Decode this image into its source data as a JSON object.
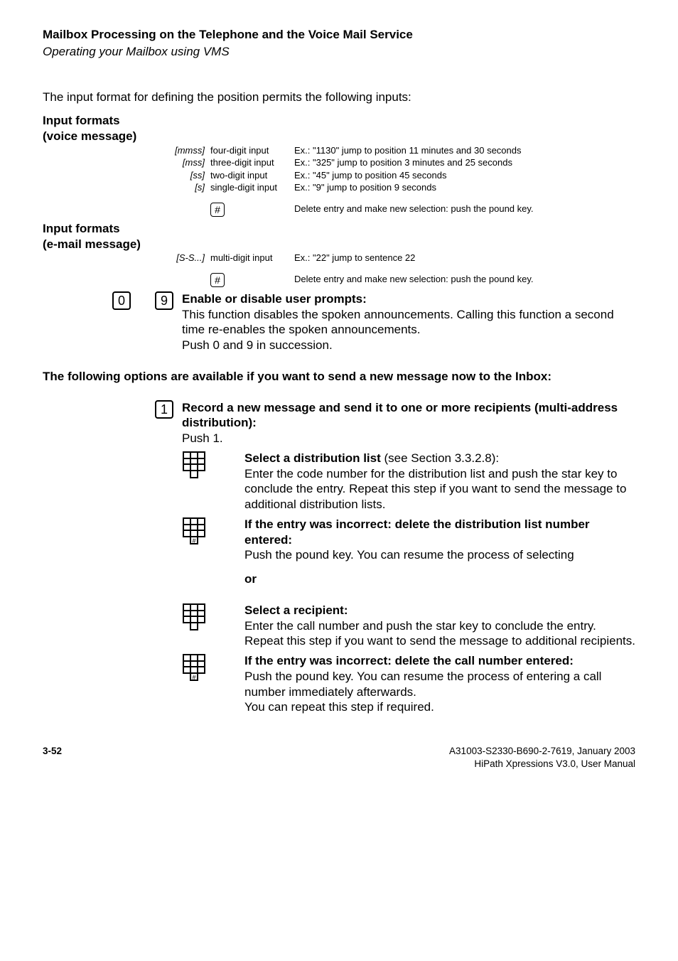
{
  "header": {
    "title": "Mailbox Processing on the Telephone and the Voice Mail Service",
    "subtitle": "Operating your Mailbox using VMS"
  },
  "intro": "The input format for defining the position permits the following inputs:",
  "input_formats_voice": {
    "heading_l1": "Input formats",
    "heading_l2": "(voice message)",
    "rows": [
      {
        "tag": "[mmss]",
        "label": "four-digit input",
        "ex": "Ex.: \"1130\" jump to position 11 minutes and 30 seconds"
      },
      {
        "tag": "[mss]",
        "label": "three-digit input",
        "ex": "Ex.: \"325\" jump to position 3 minutes and 25 seconds"
      },
      {
        "tag": "[ss]",
        "label": "two-digit input",
        "ex": "Ex.: \"45\" jump to position 45 seconds"
      },
      {
        "tag": "[s]",
        "label": "single-digit input",
        "ex": "Ex.: \"9\" jump to position 9 seconds"
      }
    ],
    "delete_key": "#",
    "delete_text": "Delete entry and make new selection: push the pound key."
  },
  "input_formats_email": {
    "heading_l1": "Input formats",
    "heading_l2": "(e-mail message)",
    "row": {
      "tag": "[S-S...]",
      "label": "multi-digit input",
      "ex": "Ex.: \"22\" jump to sentence 22"
    },
    "delete_key": "#",
    "delete_text": "Delete entry and make new selection: push the pound key."
  },
  "enable_disable": {
    "key1": "0",
    "key2": "9",
    "title": "Enable or disable user prompts:",
    "body1": "This function disables the spoken announcements. Calling this function a second time re-enables the spoken announcements.",
    "body2": "Push 0 and 9 in succession."
  },
  "options_heading": "The following options are available if you want to send a new message now to the Inbox:",
  "opt1": {
    "key": "1",
    "title": "Record a new message and send it to one or more recipients (multi-address distribution):",
    "push": "Push 1.",
    "select_dist_title": "Select a distribution list",
    "select_dist_title_suffix": " (see Section 3.3.2.8):",
    "select_dist_body": "Enter the code number for the distribution list and push the star key to conclude the entry. Repeat this step if you want to send the message to additional distribution lists.",
    "del_dist_title": "If the entry was incorrect: delete the distribution list number entered:",
    "del_dist_body": "Push the pound key. You can resume the process of selecting",
    "or": "or",
    "select_recip_title": "Select a recipient:",
    "select_recip_body": "Enter the call number and push the star key to conclude the entry. Repeat this step if you want to send the message to additional recipients.",
    "del_recip_title": "If the entry was incorrect: delete the call number entered:",
    "del_recip_body": "Push the pound key. You can resume the process of entering a call number immediately afterwards.",
    "del_recip_body2": "You can repeat this step if required."
  },
  "footer": {
    "page": "3-52",
    "right1": "A31003-S2330-B690-2-7619, January 2003",
    "right2": "HiPath Xpressions V3.0, User Manual"
  }
}
